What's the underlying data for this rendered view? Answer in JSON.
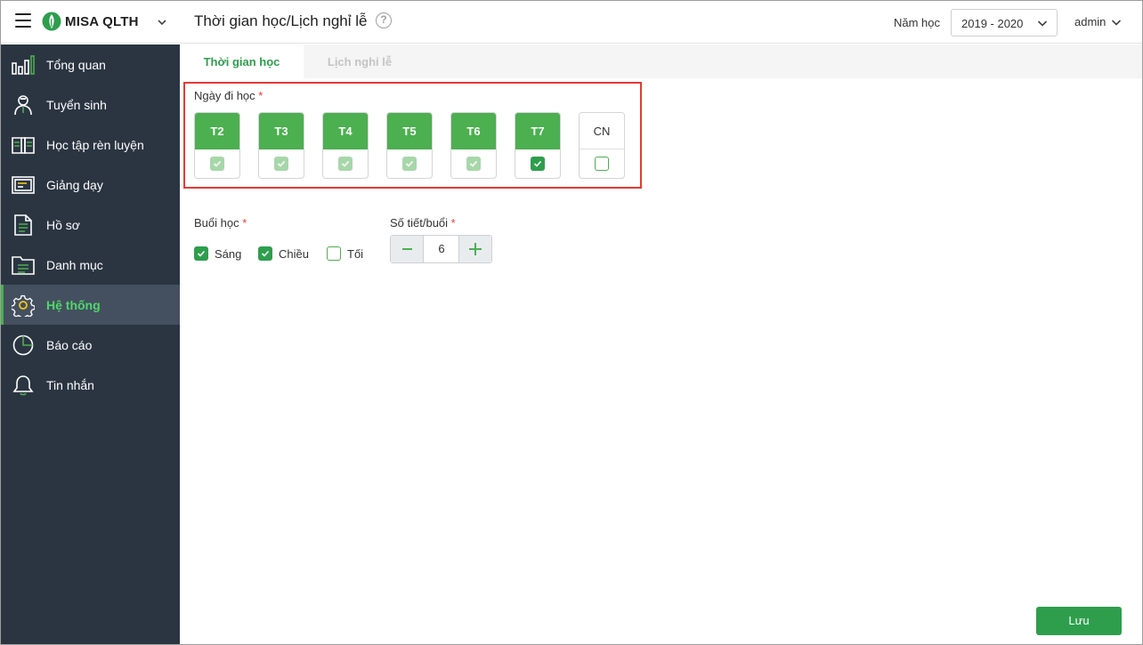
{
  "header": {
    "app_name": "MISA QLTH",
    "page_title": "Thời gian học/Lịch nghỉ lễ",
    "year_label": "Năm học",
    "year_value": "2019 - 2020",
    "user": "admin"
  },
  "sidebar": {
    "items": [
      {
        "label": "Tổng quan",
        "icon": "chart-icon"
      },
      {
        "label": "Tuyển sinh",
        "icon": "student-icon"
      },
      {
        "label": "Học tập rèn luyện",
        "icon": "book-icon"
      },
      {
        "label": "Giảng dạy",
        "icon": "board-icon"
      },
      {
        "label": "Hồ sơ",
        "icon": "document-icon"
      },
      {
        "label": "Danh mục",
        "icon": "folder-icon"
      },
      {
        "label": "Hệ thống",
        "icon": "gear-icon"
      },
      {
        "label": "Báo cáo",
        "icon": "pie-chart-icon"
      },
      {
        "label": "Tin nhắn",
        "icon": "bell-icon"
      }
    ],
    "active": "Hệ thống"
  },
  "tabs": {
    "active": "Thời gian học",
    "inactive": "Lịch nghỉ lễ"
  },
  "days": {
    "label": "Ngày đi học",
    "required_mark": "*",
    "items": [
      {
        "label": "T2",
        "checked": true
      },
      {
        "label": "T3",
        "checked": true
      },
      {
        "label": "T4",
        "checked": true
      },
      {
        "label": "T5",
        "checked": true
      },
      {
        "label": "T6",
        "checked": true
      },
      {
        "label": "T7",
        "checked": true
      },
      {
        "label": "CN",
        "checked": false
      }
    ]
  },
  "sessions": {
    "label": "Buổi học",
    "required_mark": "*",
    "items": [
      {
        "label": "Sáng",
        "checked": true
      },
      {
        "label": "Chiều",
        "checked": true
      },
      {
        "label": "Tối",
        "checked": false
      }
    ]
  },
  "periods": {
    "label": "Số tiết/buổi",
    "required_mark": "*",
    "value": "6"
  },
  "save_label": "Lưu",
  "colors": {
    "accent": "#4caf50",
    "sidebar_bg": "#2b3542",
    "highlight_border": "#e53935"
  }
}
